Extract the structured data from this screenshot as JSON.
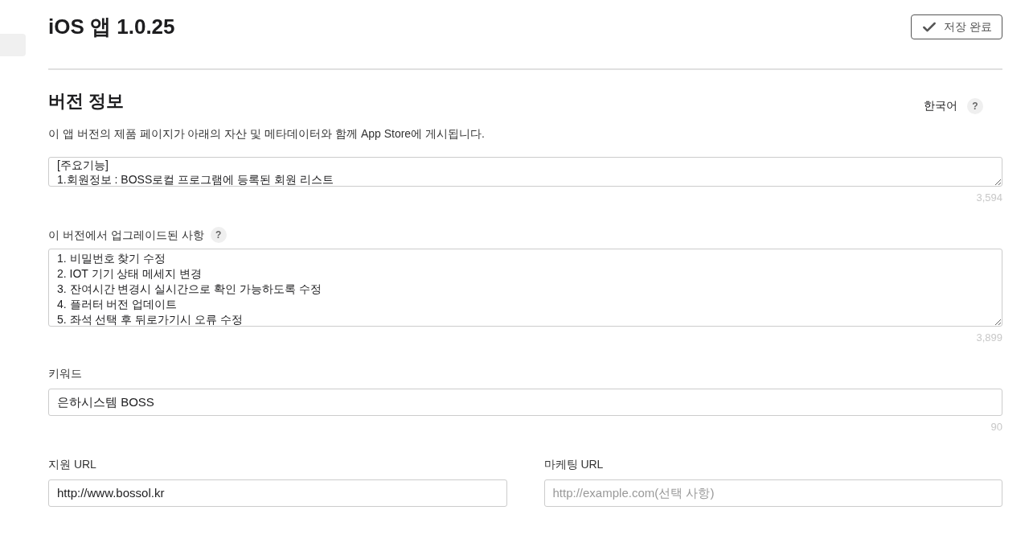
{
  "page": {
    "title": "iOS 앱 1.0.25",
    "save_button": "저장 완료"
  },
  "section": {
    "title": "버전 정보",
    "language": "한국어",
    "language_help": "?",
    "description": "이 앱 버전의 제품 페이지가 아래의 자산 및 메타데이터와 함께 App Store에 게시됩니다."
  },
  "description_field": {
    "lines": [
      "[주요기능]",
      "1.회원정보 : BOSS로컬 프로그램에 등록된 회원 리스트"
    ],
    "counter": "3,594"
  },
  "whats_new": {
    "label": "이 버전에서 업그레이드된 사항",
    "help": "?",
    "lines": [
      "1. 비밀번호 찾기 수정",
      "2. IOT 기기 상태 메세지 변경",
      "3. 잔여시간 변경시 실시간으로 확인 가능하도록 수정",
      "4. 플러터 버전 업데이트",
      "5. 좌석 선택 후 뒤로가기시 오류 수정"
    ],
    "counter": "3,899"
  },
  "keywords": {
    "label": "키워드",
    "value": "은하시스템 BOSS",
    "counter": "90"
  },
  "support_url": {
    "label": "지원 URL",
    "value": "http://www.bossol.kr"
  },
  "marketing_url": {
    "label": "마케팅 URL",
    "placeholder": "http://example.com(선택 사항)"
  }
}
